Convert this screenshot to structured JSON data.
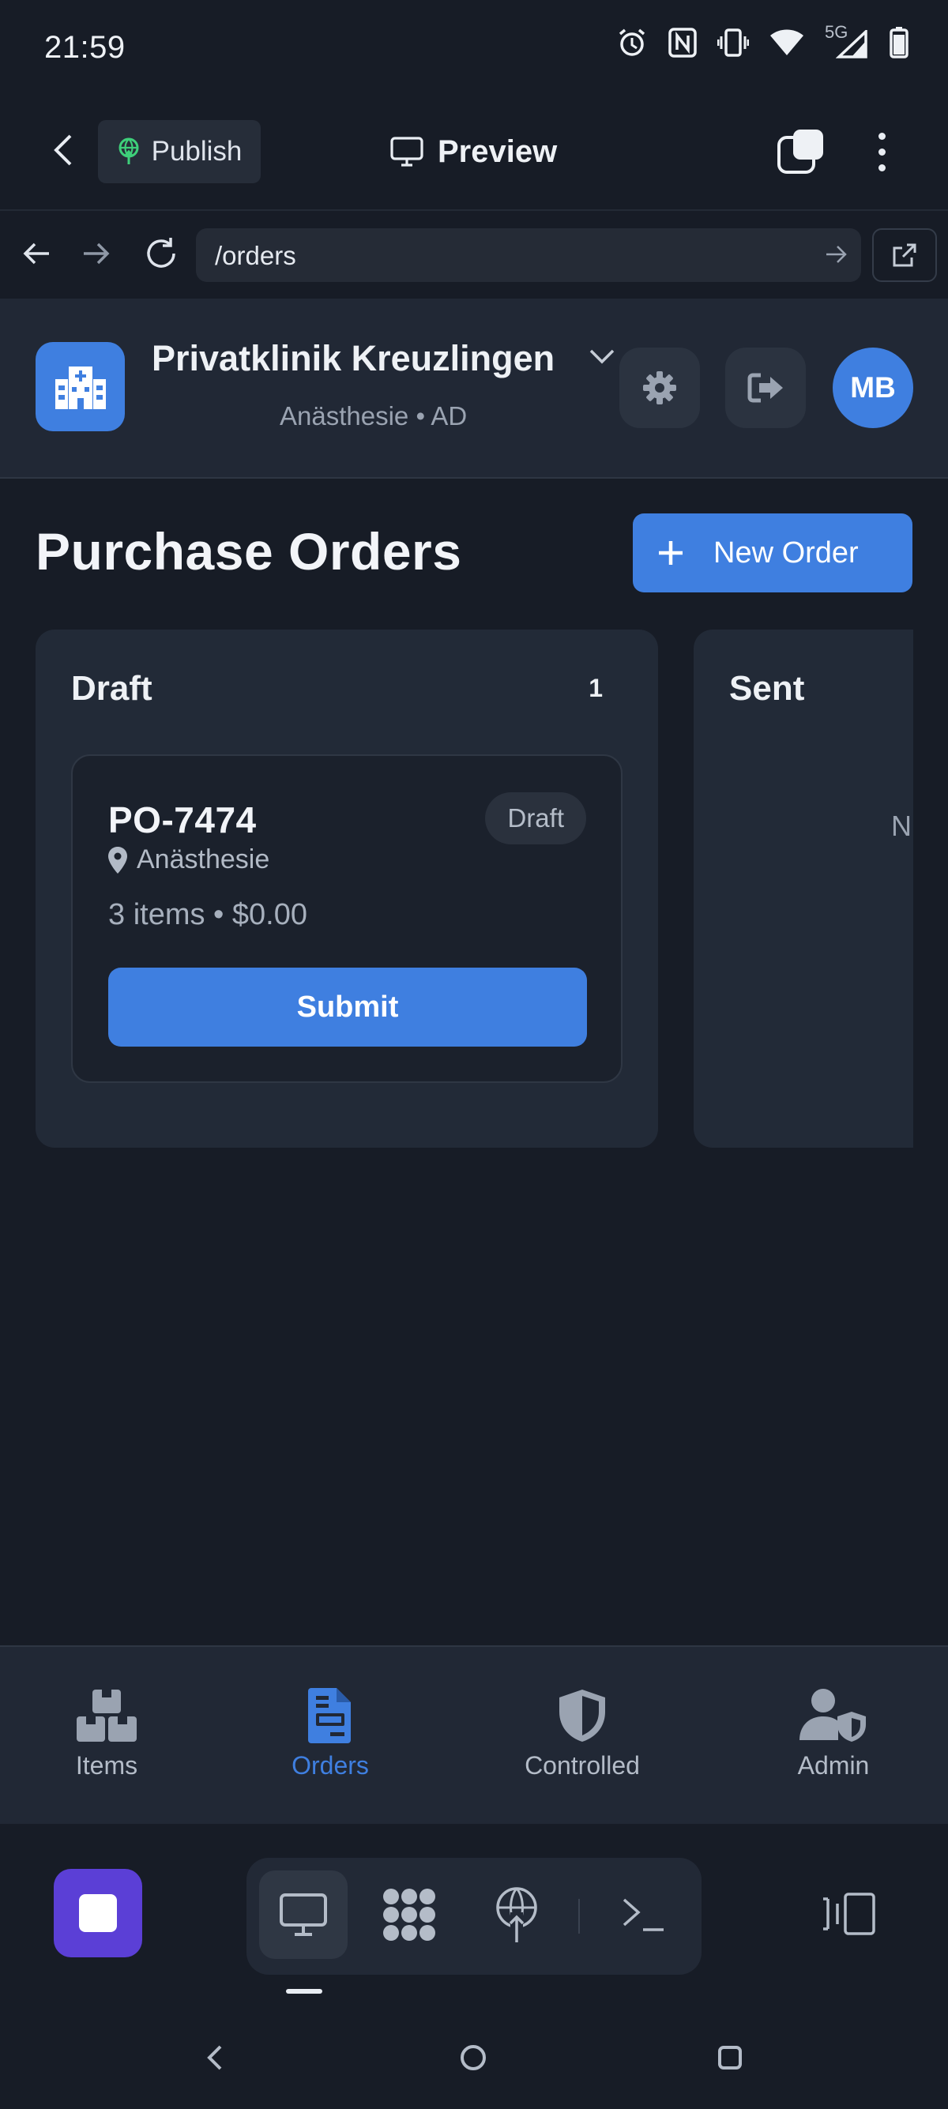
{
  "status_bar": {
    "time": "21:59",
    "network": "5G",
    "icons": [
      "alarm-icon",
      "nfc-icon",
      "vibrate-icon",
      "wifi-icon",
      "signal-icon",
      "battery-icon"
    ]
  },
  "toolbar": {
    "publish_label": "Publish",
    "preview_label": "Preview"
  },
  "browser": {
    "url": "/orders"
  },
  "app_header": {
    "clinic_name": "Privatklinik Kreuzlingen",
    "clinic_subtitle": "Anästhesie • AD",
    "avatar_initials": "MB"
  },
  "page": {
    "title": "Purchase Orders",
    "new_order_label": "New Order"
  },
  "columns": [
    {
      "title": "Draft",
      "count": "1",
      "orders": [
        {
          "id": "PO-7474",
          "status": "Draft",
          "location": "Anästhesie",
          "summary": "3 items • $0.00",
          "action": "Submit"
        }
      ]
    },
    {
      "title": "Sent",
      "empty_text": "N"
    }
  ],
  "bottom_nav": {
    "items": [
      {
        "label": "Items",
        "icon": "boxes-icon"
      },
      {
        "label": "Orders",
        "icon": "file-invoice-icon",
        "active": true
      },
      {
        "label": "Controlled",
        "icon": "shield-icon"
      },
      {
        "label": "Admin",
        "icon": "user-shield-icon"
      }
    ]
  },
  "colors": {
    "accent": "#3f7fe0",
    "background": "#171c26",
    "surface": "#212835",
    "stop_button": "#5b3fd6"
  }
}
